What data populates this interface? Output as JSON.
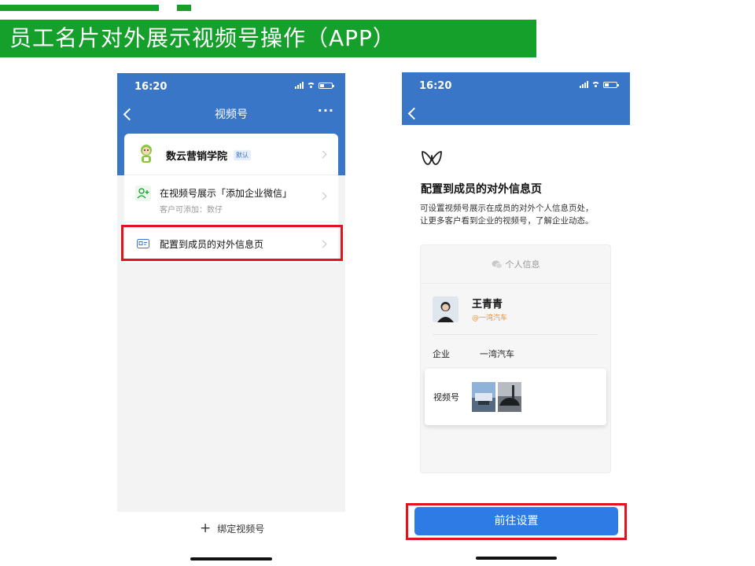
{
  "page_title": "员工名片对外展示视频号操作（APP）",
  "left_phone": {
    "time": "16:20",
    "nav_title": "视频号",
    "more": "···",
    "account": {
      "name": "数云营销学院",
      "badge": "默认"
    },
    "show_item": {
      "title": "在视频号展示「添加企业微信」",
      "subtitle": "客户可添加：数仔"
    },
    "config_item": {
      "title": "配置到成员的对外信息页"
    },
    "bind": {
      "plus": "+",
      "label": "绑定视频号"
    }
  },
  "right_phone": {
    "time": "16:20",
    "heading": "配置到成员的对外信息页",
    "desc_line1": "可设置视频号展示在成员的对外个人信息页处，",
    "desc_line2": "让更多客户看到企业的视频号，了解企业动态。",
    "preview": {
      "header": "个人信息",
      "name": "王青青",
      "company_handle": "@一湾汽车",
      "enterprise_label": "企业",
      "enterprise_value": "一湾汽车",
      "channels_label": "视频号"
    },
    "button": "前往设置"
  },
  "colors": {
    "green": "#14a02a",
    "blue": "#3a76c8",
    "red": "#e0141e",
    "button": "#2e7be5",
    "orange": "#f0913a"
  }
}
